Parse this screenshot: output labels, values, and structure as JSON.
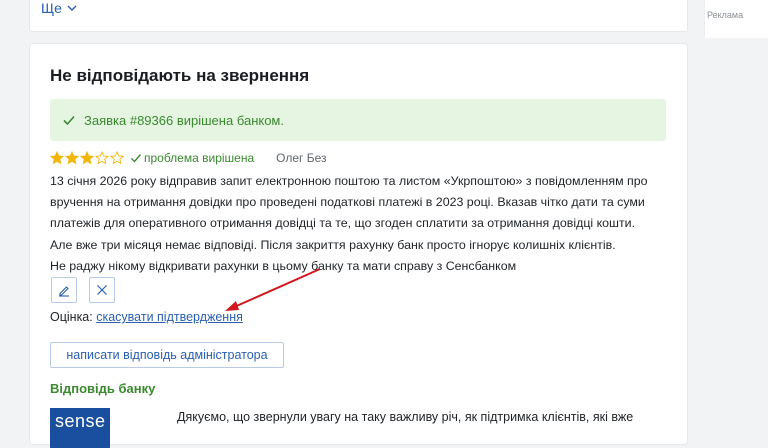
{
  "top": {
    "more_label": "Ще"
  },
  "ad": {
    "label": "Реклама"
  },
  "review": {
    "title": "Не відповідають на звернення",
    "resolved_prefix": "Заявка ",
    "ticket": "#89366",
    "resolved_suffix": " вирішена банком.",
    "rating": 3,
    "max_rating": 5,
    "status": "проблема вирішена",
    "author": "Олег Без",
    "paragraphs": [
      "13 січня 2026 року відправив запит електронною поштою та листом «Укрпоштою» з повідомленням про",
      "вручення на отримання довідки про проведені податкові платежі в 2023 році. Вказав чітко дати та суми",
      "платежів для оперативного отримання довідці та те, що згоден сплатити за отримання довідці кошти.",
      "Але вже три місяця немає відповіді. Після закриття рахунку банк просто ігнорує колишніх клієнтів.",
      "Не раджу нікому відкривати рахунки в цьому банку та мати справу з Сенсбанком"
    ],
    "rating_label": "Оцінка: ",
    "cancel_confirm": "скасувати підтвердження",
    "reply_admin_button": "написати відповідь адміністратора"
  },
  "bank_reply": {
    "title": "Відповідь банку",
    "logo_text": "sense",
    "text": "Дякуємо, що звернули увагу на таку важливу річ, як підтримка клієнтів, які вже"
  },
  "colors": {
    "accent_blue": "#2a5fb0",
    "success_green": "#3a8a2e",
    "success_bg": "#e5f5e2",
    "star_gold": "#f2b705",
    "arrow_red": "#d0191e",
    "logo_blue": "#1a4fa0"
  },
  "icons": [
    "chevron-down-icon",
    "check-icon",
    "star-icon",
    "pencil-icon",
    "close-icon"
  ]
}
